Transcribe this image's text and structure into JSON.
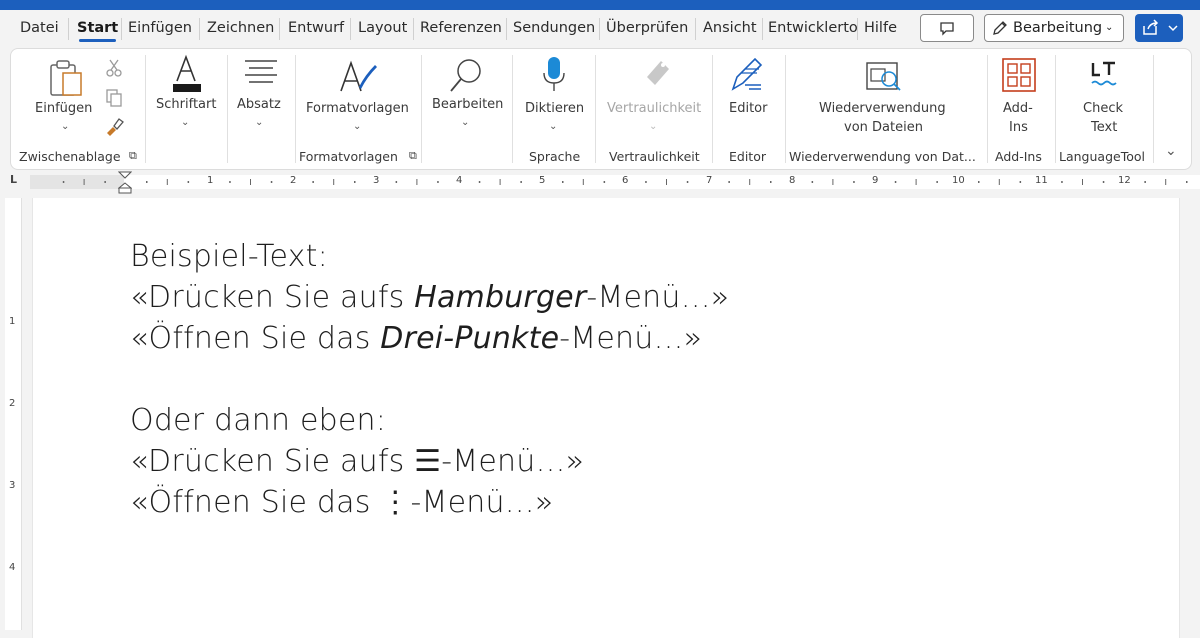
{
  "tabs": [
    "Datei",
    "Start",
    "Einfügen",
    "Zeichnen",
    "Entwurf",
    "Layout",
    "Referenzen",
    "Sendungen",
    "Überprüfen",
    "Ansicht",
    "Entwicklerto",
    "Hilfe"
  ],
  "header": {
    "edit_mode": "Bearbeitung"
  },
  "ribbon": {
    "paste": "Einfügen",
    "font": "Schriftart",
    "paragraph": "Absatz",
    "styles": "Formatvorlagen",
    "editing": "Bearbeiten",
    "dictate": "Diktieren",
    "sensitivity": "Vertraulichkeit",
    "editor": "Editor",
    "reuse_line1": "Wiederverwendung",
    "reuse_line2": "von Dateien",
    "addins_line1": "Add-",
    "addins_line2": "Ins",
    "check_line1": "Check",
    "check_line2": "Text",
    "groups": {
      "clipboard": "Zwischenablage",
      "styles": "Formatvorlagen",
      "voice": "Sprache",
      "sensitivity": "Vertraulichkeit",
      "editor": "Editor",
      "reuse": "Wiederverwendung von Dat...",
      "addins": "Add-Ins",
      "languagetool": "LanguageTool"
    }
  },
  "ruler": {
    "numbers": [
      "1",
      "2",
      "3",
      "4",
      "5",
      "6",
      "7",
      "8",
      "9",
      "10",
      "11",
      "12"
    ],
    "vnumbers": [
      "1",
      "2",
      "3",
      "4"
    ]
  },
  "document": {
    "l1": "Beispiel-Text:",
    "l2a": "«Drücken Sie aufs ",
    "l2b": "Hamburger",
    "l2c": "-Menü…»",
    "l3a": "«Öffnen Sie das ",
    "l3b": "Drei-Punkte",
    "l3c": "-Menü…»",
    "l4": "Oder dann eben:",
    "l5": "«Drücken Sie aufs ☰-Menü…»",
    "l6": "«Öffnen Sie das ⋮-Menü…»"
  },
  "colors": {
    "accent": "#1c5fbd",
    "styles_icon": "#1c5fbd",
    "addins_icon": "#c43e1c"
  }
}
